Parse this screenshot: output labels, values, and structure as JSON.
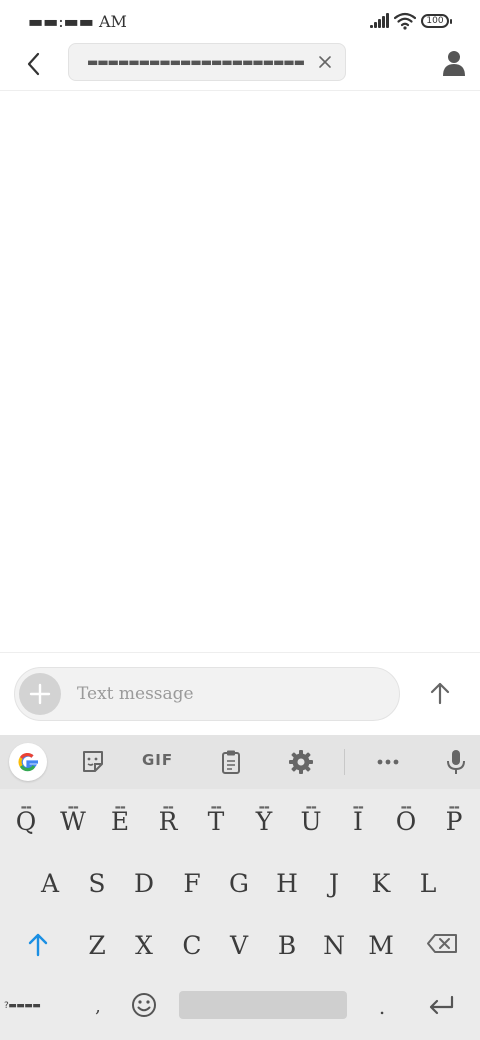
{
  "status_bar": {
    "time": "▬▬:▬▬ AM",
    "battery": "100"
  },
  "header": {
    "recipient": "▬▬▬▬▬▬▬▬▬▬▬▬▬▬▬▬▬▬▬▬▬"
  },
  "composer": {
    "placeholder": "Text message"
  },
  "keyboard": {
    "toolbar": {
      "gif_label": "GIF"
    },
    "rows": [
      [
        "Q",
        "W",
        "E",
        "R",
        "T",
        "Y",
        "U",
        "I",
        "O",
        "P"
      ],
      [
        "A",
        "S",
        "D",
        "F",
        "G",
        "H",
        "J",
        "K",
        "L"
      ],
      [
        "Z",
        "X",
        "C",
        "V",
        "B",
        "N",
        "M"
      ]
    ],
    "hints": [
      "▬▬",
      "▬▬",
      "▬▬",
      "▬▬",
      "▬▬",
      "▬▬",
      "▬▬",
      "▬▬",
      "▬▬",
      "▬▬"
    ],
    "symbols_label": "?▬▬▬▬",
    "comma": ",",
    "period": "."
  },
  "colors": {
    "accent": "#1a8fe3",
    "keyboard_bg": "#ebebeb",
    "toolbar_bg": "#e4e4e4",
    "icon": "#666666"
  }
}
